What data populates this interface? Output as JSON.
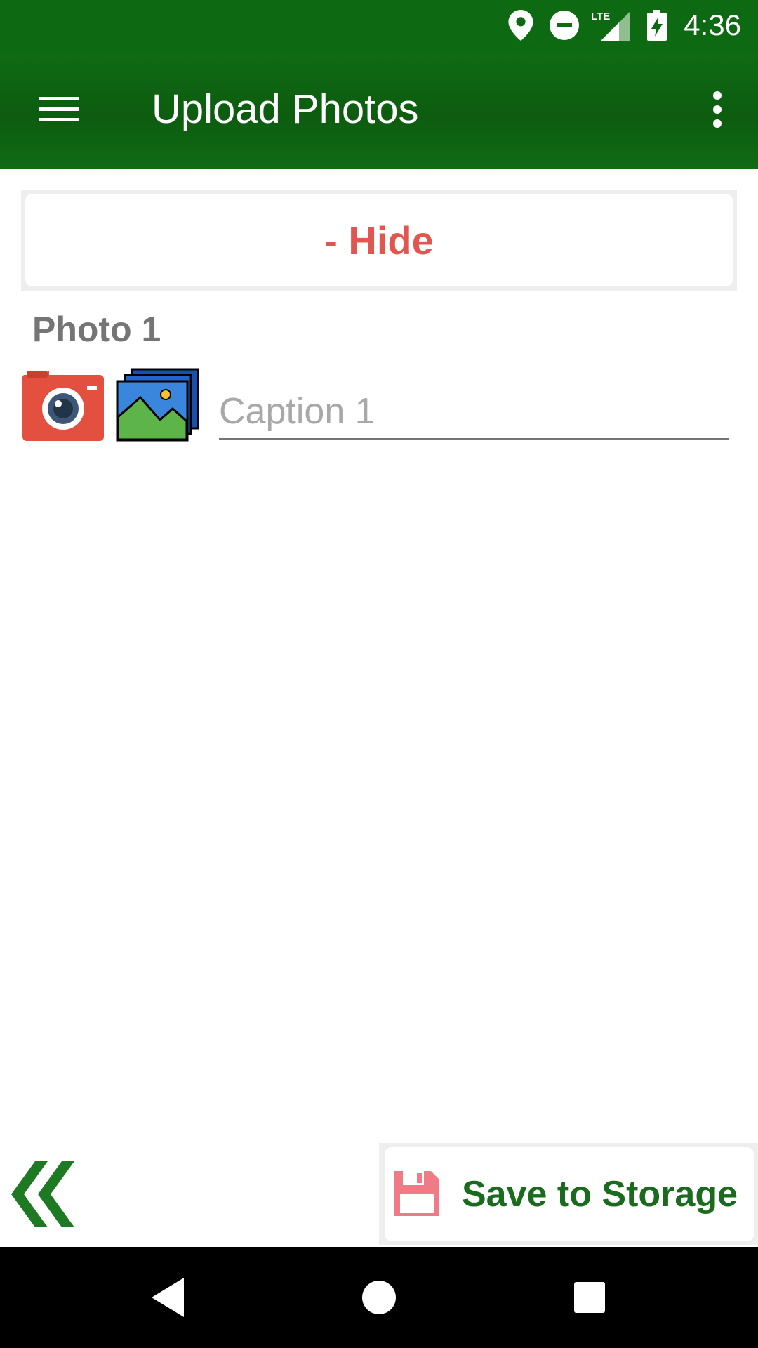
{
  "status_bar": {
    "time": "4:36",
    "network": "LTE",
    "icons": [
      "location-icon",
      "do-not-disturb-icon",
      "lte-signal-icon",
      "battery-charging-icon"
    ]
  },
  "app_bar": {
    "title": "Upload Photos",
    "menu_icon": "hamburger-menu-icon",
    "overflow_icon": "more-vert-icon"
  },
  "toggle": {
    "label": "- Hide"
  },
  "photo": {
    "label": "Photo 1",
    "caption_placeholder": "Caption 1",
    "caption_value": "",
    "camera_icon": "camera-icon",
    "gallery_icon": "gallery-icon"
  },
  "footer": {
    "back_icon": "double-chevron-left-icon",
    "save_label": "Save to Storage",
    "save_icon": "floppy-disk-icon"
  },
  "colors": {
    "primary": "#0e6a12",
    "accent_red": "#e0574f",
    "save_text": "#1b6b1e",
    "label_gray": "#757575"
  }
}
